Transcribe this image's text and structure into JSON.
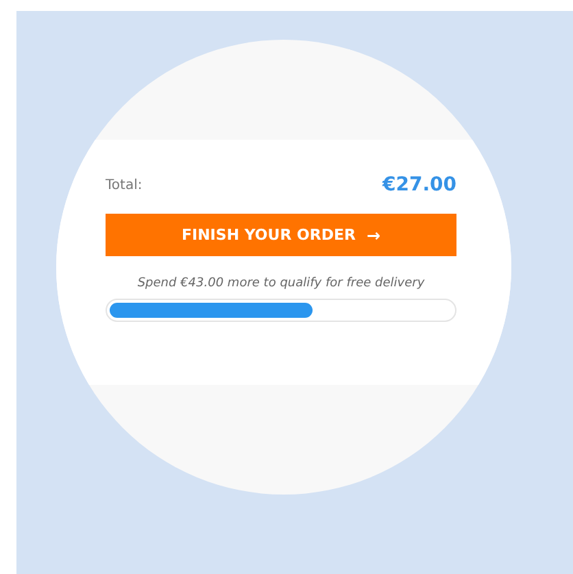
{
  "total": {
    "label": "Total:",
    "amount": "€27.00"
  },
  "button": {
    "label": "FINISH YOUR ORDER",
    "arrow": "→"
  },
  "delivery": {
    "message": "Spend €43.00 more to qualify for free delivery",
    "level": 0.59
  }
}
